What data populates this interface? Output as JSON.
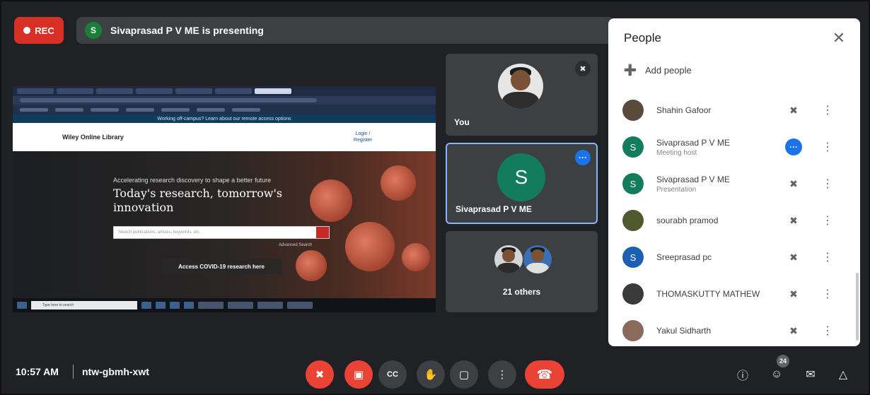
{
  "top_bar": {
    "rec_label": "REC",
    "presenter_initial": "S",
    "presenting_text": "Sivaprasad P V ME is presenting"
  },
  "shared_screen": {
    "offcampus_text": "Working off-campus? Learn about our remote access options",
    "site_name": "Wiley Online Library",
    "login_label": "Login /",
    "register_label": "Register",
    "hero_subtitle": "Accelerating research discovery to shape a better future",
    "hero_title": "Today's research, tomorrow's innovation",
    "search_placeholder": "Search publications, articles, keywords, etc.",
    "advanced_search": "Advanced Search",
    "covid_button": "Access COVID-19 research here",
    "taskbar_search": "Type here to search"
  },
  "tiles": {
    "you_label": "You",
    "presenter_initial": "S",
    "presenter_name": "Sivaprasad P V ME",
    "others_label": "21 others"
  },
  "people_panel": {
    "title": "People",
    "add_people": "Add people",
    "participants": [
      {
        "name": "Shahin Gafoor",
        "role": "",
        "initial": "",
        "avatar": "photo",
        "mic": "mic-off-icon"
      },
      {
        "name": "Sivaprasad P V ME",
        "role": "Meeting host",
        "initial": "S",
        "avatar_color": "#137c5a",
        "mic": "speaking-icon"
      },
      {
        "name": "Sivaprasad P V ME",
        "role": "Presentation",
        "initial": "S",
        "avatar_color": "#137c5a",
        "mic": "presentation-audio-off-icon"
      },
      {
        "name": "sourabh pramod",
        "role": "",
        "initial": "",
        "avatar": "photo",
        "mic": "mic-off-icon"
      },
      {
        "name": "Sreeprasad pc",
        "role": "",
        "initial": "S",
        "avatar_color": "#1a5fb4",
        "mic": "mic-off-icon"
      },
      {
        "name": "THOMASKUTTY MATHEW",
        "role": "",
        "initial": "",
        "avatar": "photo",
        "mic": "mic-off-icon"
      },
      {
        "name": "Yakul Sidharth",
        "role": "",
        "initial": "",
        "avatar": "photo",
        "mic": "mic-off-icon"
      }
    ]
  },
  "bottom_bar": {
    "time": "10:57 AM",
    "meeting_code": "ntw-gbmh-xwt",
    "people_count": "24"
  },
  "colors": {
    "background": "#202124",
    "tile": "#3c4043",
    "accent_red": "#ea4335",
    "accent_blue": "#1a73e8",
    "host_green": "#137c5a"
  }
}
